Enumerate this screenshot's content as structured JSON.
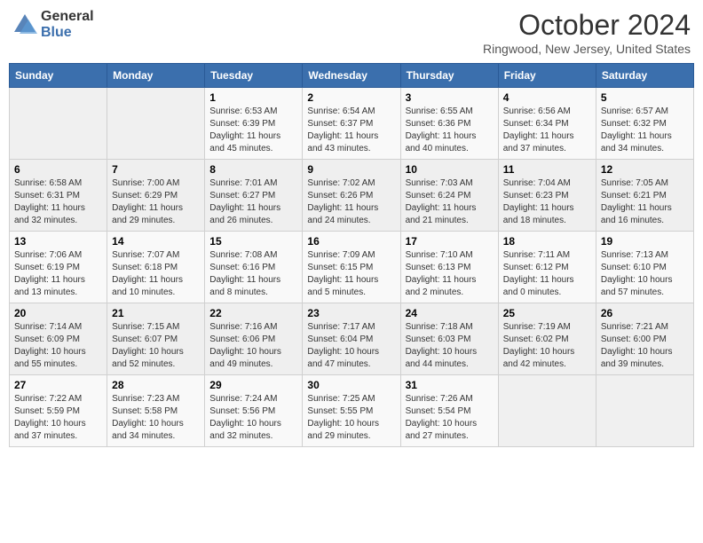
{
  "header": {
    "logo_general": "General",
    "logo_blue": "Blue",
    "month_title": "October 2024",
    "location": "Ringwood, New Jersey, United States"
  },
  "weekdays": [
    "Sunday",
    "Monday",
    "Tuesday",
    "Wednesday",
    "Thursday",
    "Friday",
    "Saturday"
  ],
  "weeks": [
    [
      {
        "day": "",
        "info": ""
      },
      {
        "day": "",
        "info": ""
      },
      {
        "day": "1",
        "info": "Sunrise: 6:53 AM\nSunset: 6:39 PM\nDaylight: 11 hours and 45 minutes."
      },
      {
        "day": "2",
        "info": "Sunrise: 6:54 AM\nSunset: 6:37 PM\nDaylight: 11 hours and 43 minutes."
      },
      {
        "day": "3",
        "info": "Sunrise: 6:55 AM\nSunset: 6:36 PM\nDaylight: 11 hours and 40 minutes."
      },
      {
        "day": "4",
        "info": "Sunrise: 6:56 AM\nSunset: 6:34 PM\nDaylight: 11 hours and 37 minutes."
      },
      {
        "day": "5",
        "info": "Sunrise: 6:57 AM\nSunset: 6:32 PM\nDaylight: 11 hours and 34 minutes."
      }
    ],
    [
      {
        "day": "6",
        "info": "Sunrise: 6:58 AM\nSunset: 6:31 PM\nDaylight: 11 hours and 32 minutes."
      },
      {
        "day": "7",
        "info": "Sunrise: 7:00 AM\nSunset: 6:29 PM\nDaylight: 11 hours and 29 minutes."
      },
      {
        "day": "8",
        "info": "Sunrise: 7:01 AM\nSunset: 6:27 PM\nDaylight: 11 hours and 26 minutes."
      },
      {
        "day": "9",
        "info": "Sunrise: 7:02 AM\nSunset: 6:26 PM\nDaylight: 11 hours and 24 minutes."
      },
      {
        "day": "10",
        "info": "Sunrise: 7:03 AM\nSunset: 6:24 PM\nDaylight: 11 hours and 21 minutes."
      },
      {
        "day": "11",
        "info": "Sunrise: 7:04 AM\nSunset: 6:23 PM\nDaylight: 11 hours and 18 minutes."
      },
      {
        "day": "12",
        "info": "Sunrise: 7:05 AM\nSunset: 6:21 PM\nDaylight: 11 hours and 16 minutes."
      }
    ],
    [
      {
        "day": "13",
        "info": "Sunrise: 7:06 AM\nSunset: 6:19 PM\nDaylight: 11 hours and 13 minutes."
      },
      {
        "day": "14",
        "info": "Sunrise: 7:07 AM\nSunset: 6:18 PM\nDaylight: 11 hours and 10 minutes."
      },
      {
        "day": "15",
        "info": "Sunrise: 7:08 AM\nSunset: 6:16 PM\nDaylight: 11 hours and 8 minutes."
      },
      {
        "day": "16",
        "info": "Sunrise: 7:09 AM\nSunset: 6:15 PM\nDaylight: 11 hours and 5 minutes."
      },
      {
        "day": "17",
        "info": "Sunrise: 7:10 AM\nSunset: 6:13 PM\nDaylight: 11 hours and 2 minutes."
      },
      {
        "day": "18",
        "info": "Sunrise: 7:11 AM\nSunset: 6:12 PM\nDaylight: 11 hours and 0 minutes."
      },
      {
        "day": "19",
        "info": "Sunrise: 7:13 AM\nSunset: 6:10 PM\nDaylight: 10 hours and 57 minutes."
      }
    ],
    [
      {
        "day": "20",
        "info": "Sunrise: 7:14 AM\nSunset: 6:09 PM\nDaylight: 10 hours and 55 minutes."
      },
      {
        "day": "21",
        "info": "Sunrise: 7:15 AM\nSunset: 6:07 PM\nDaylight: 10 hours and 52 minutes."
      },
      {
        "day": "22",
        "info": "Sunrise: 7:16 AM\nSunset: 6:06 PM\nDaylight: 10 hours and 49 minutes."
      },
      {
        "day": "23",
        "info": "Sunrise: 7:17 AM\nSunset: 6:04 PM\nDaylight: 10 hours and 47 minutes."
      },
      {
        "day": "24",
        "info": "Sunrise: 7:18 AM\nSunset: 6:03 PM\nDaylight: 10 hours and 44 minutes."
      },
      {
        "day": "25",
        "info": "Sunrise: 7:19 AM\nSunset: 6:02 PM\nDaylight: 10 hours and 42 minutes."
      },
      {
        "day": "26",
        "info": "Sunrise: 7:21 AM\nSunset: 6:00 PM\nDaylight: 10 hours and 39 minutes."
      }
    ],
    [
      {
        "day": "27",
        "info": "Sunrise: 7:22 AM\nSunset: 5:59 PM\nDaylight: 10 hours and 37 minutes."
      },
      {
        "day": "28",
        "info": "Sunrise: 7:23 AM\nSunset: 5:58 PM\nDaylight: 10 hours and 34 minutes."
      },
      {
        "day": "29",
        "info": "Sunrise: 7:24 AM\nSunset: 5:56 PM\nDaylight: 10 hours and 32 minutes."
      },
      {
        "day": "30",
        "info": "Sunrise: 7:25 AM\nSunset: 5:55 PM\nDaylight: 10 hours and 29 minutes."
      },
      {
        "day": "31",
        "info": "Sunrise: 7:26 AM\nSunset: 5:54 PM\nDaylight: 10 hours and 27 minutes."
      },
      {
        "day": "",
        "info": ""
      },
      {
        "day": "",
        "info": ""
      }
    ]
  ]
}
